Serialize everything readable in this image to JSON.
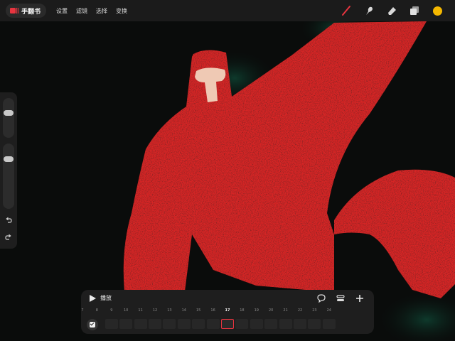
{
  "app": {
    "gallery_label": "手翻书",
    "menu": [
      "设置",
      "滤镜",
      "选择",
      "变换"
    ]
  },
  "toolbar": {
    "tools": [
      "brush-icon",
      "smudge-icon",
      "eraser-icon",
      "layers-icon"
    ],
    "active_tool": "brush-icon",
    "active_color": "#f5b800",
    "accent_color": "#e8343f"
  },
  "sidebar": {
    "buttons": [
      "undo-icon",
      "redo-icon"
    ]
  },
  "timeline": {
    "play_label": "播放",
    "frame_numbers": [
      "7",
      "8",
      "9",
      "10",
      "11",
      "12",
      "13",
      "14",
      "15",
      "16",
      "17",
      "18",
      "19",
      "20",
      "21",
      "22",
      "23",
      "24"
    ],
    "current_frame": "17",
    "icons": [
      "comment-icon",
      "settings-icon",
      "add-icon"
    ]
  }
}
